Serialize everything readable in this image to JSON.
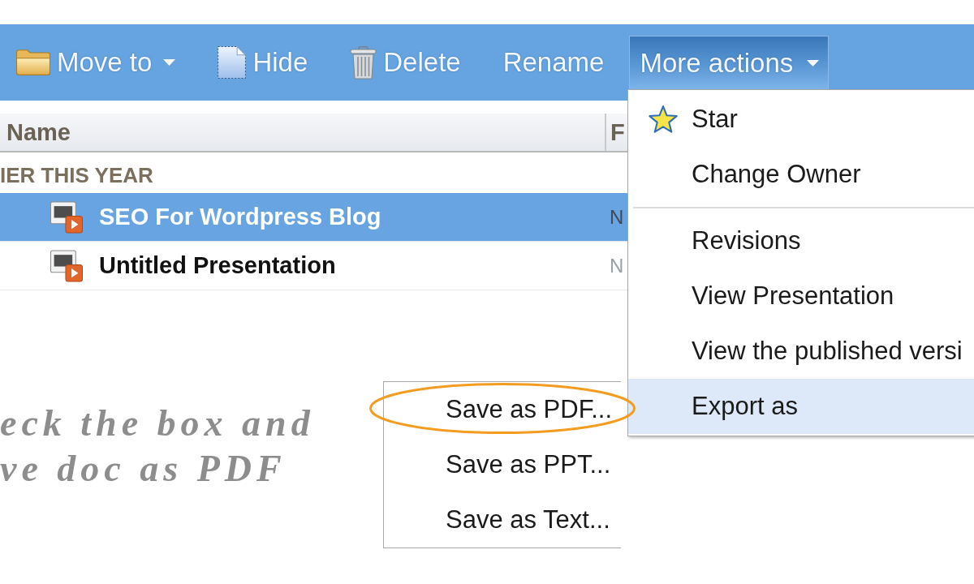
{
  "toolbar": {
    "buttons": [
      {
        "kind": "move",
        "label": "Move to",
        "dropdown": true,
        "selected": false
      },
      {
        "kind": "hide",
        "label": "Hide",
        "dropdown": false,
        "selected": false
      },
      {
        "kind": "delete",
        "label": "Delete",
        "dropdown": false,
        "selected": false
      },
      {
        "kind": "rename",
        "label": "Rename",
        "dropdown": false,
        "selected": false
      },
      {
        "kind": "more",
        "label": "More actions",
        "dropdown": true,
        "selected": true
      }
    ]
  },
  "table": {
    "columns": [
      {
        "label": "Name"
      },
      {
        "label": "F"
      }
    ],
    "groups": [
      {
        "label": "IER THIS YEAR",
        "rows": [
          {
            "name": "SEO For Wordpress Blog",
            "column_2": "N",
            "selected": true
          },
          {
            "name": "Untitled Presentation",
            "column_2": "N",
            "selected": false
          }
        ]
      }
    ]
  },
  "annotation": {
    "lines": [
      "eck the box and",
      "ve doc as PDF"
    ]
  },
  "actions_menu": {
    "sections": [
      {
        "items": [
          {
            "kind": "toggle",
            "label": "Star",
            "selected": false
          },
          {
            "kind": "command",
            "label": "Change Owner",
            "selected": false
          }
        ]
      },
      {
        "items": [
          {
            "kind": "command",
            "label": "Revisions",
            "selected": false
          },
          {
            "kind": "command",
            "label": "View Presentation",
            "selected": false
          },
          {
            "kind": "command",
            "label": "View the published versi",
            "selected": false
          },
          {
            "kind": "command",
            "label": "Export as",
            "selected": true,
            "submenu": {
              "items": [
                {
                  "label": "Save as PDF...",
                  "circled": true
                },
                {
                  "label": "Save as PPT...",
                  "circled": false
                },
                {
                  "label": "Save as Text...",
                  "circled": false
                }
              ]
            }
          }
        ]
      }
    ]
  }
}
